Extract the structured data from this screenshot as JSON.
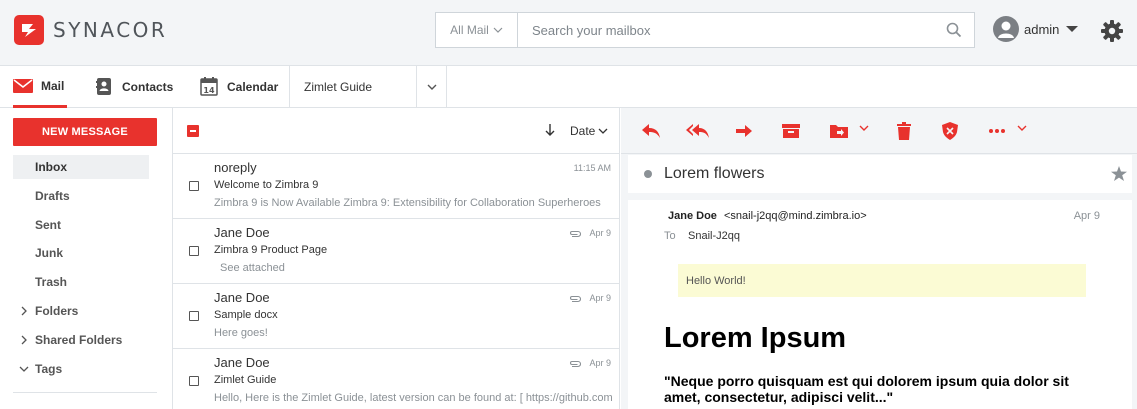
{
  "header": {
    "brand": "SYNACOR",
    "search_scope": "All Mail",
    "search_placeholder": "Search your mailbox",
    "user_name": "admin"
  },
  "nav": {
    "mail": "Mail",
    "contacts": "Contacts",
    "calendar": "Calendar",
    "calendar_day": "14",
    "zimlet": "Zimlet Guide"
  },
  "sidebar": {
    "new_message": "NEW MESSAGE",
    "folders": [
      "Inbox",
      "Drafts",
      "Sent",
      "Junk",
      "Trash"
    ],
    "groups": [
      "Folders",
      "Shared Folders",
      "Tags"
    ]
  },
  "list": {
    "sort_label": "Date",
    "messages": [
      {
        "from": "noreply",
        "subject": "Welcome to Zimbra 9",
        "preview": "Zimbra 9 is Now Available Zimbra 9: Extensibility for Collaboration Superheroes",
        "date": "11:15 AM",
        "attachment": false
      },
      {
        "from": "Jane Doe",
        "subject": "Zimbra 9 Product Page",
        "preview": "See attached",
        "date": "Apr 9",
        "attachment": true
      },
      {
        "from": "Jane Doe",
        "subject": "Sample docx",
        "preview": "Here goes!",
        "date": "Apr 9",
        "attachment": true
      },
      {
        "from": "Jane Doe",
        "subject": "Zimlet Guide",
        "preview": "Hello, Here is the Zimlet Guide, latest version can be found at: [ https://github.com",
        "date": "Apr 9",
        "attachment": true
      }
    ]
  },
  "reader": {
    "subject": "Lorem flowers",
    "sender_name": "Jane Doe",
    "sender_email": "<snail-j2qq@mind.zimbra.io>",
    "date": "Apr 9",
    "to_label": "To",
    "to_value": "Snail-J2qq",
    "hello": "Hello World!",
    "heading": "Lorem Ipsum",
    "quote": "\"Neque porro quisquam est qui dolorem ipsum quia dolor sit amet, consectetur, adipisci velit...\""
  },
  "colors": {
    "accent": "#e8322d",
    "header_bg": "#f3f5f7",
    "border": "#dfe3e7",
    "muted_text": "#8b9196",
    "highlight": "#fbfbd4"
  }
}
